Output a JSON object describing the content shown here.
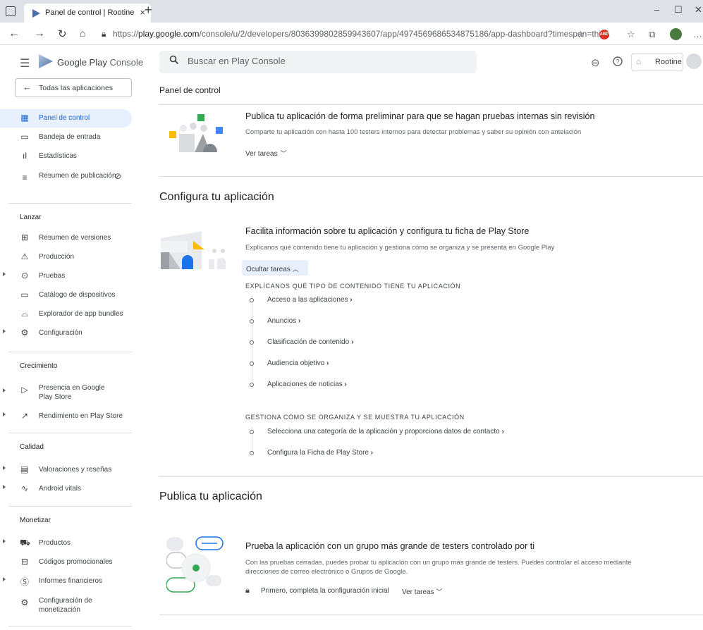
{
  "browser": {
    "tab_title": "Panel de control | Rootine",
    "tab_close": "×",
    "new_tab": "+",
    "url_prefix": "https://",
    "url_domain": "play.google.com",
    "url_path": "/console/u/2/developers/8036399802859943607/app/4974569686534875186/app-dashboard?timespan=thir...",
    "abp_label": "ABP"
  },
  "header": {
    "brand_main": "Google Play",
    "brand_sub": "Console",
    "search_placeholder": "Buscar en Play Console",
    "developer_name": "Rootine"
  },
  "sidebar": {
    "back_label": "Todas las aplicaciones",
    "top_items": [
      {
        "label": "Panel de control",
        "icon": "dashboard-icon"
      },
      {
        "label": "Bandeja de entrada",
        "icon": "inbox-icon"
      },
      {
        "label": "Estadísticas",
        "icon": "bar-chart-icon"
      },
      {
        "label": "Resumen de publicación",
        "icon": "publishing-overview-icon"
      }
    ],
    "sections": [
      {
        "title": "Lanzar",
        "items": [
          {
            "label": "Resumen de versiones"
          },
          {
            "label": "Producción"
          },
          {
            "label": "Pruebas"
          },
          {
            "label": "Catálogo de dispositivos"
          },
          {
            "label": "Explorador de app bundles"
          },
          {
            "label": "Configuración"
          }
        ]
      },
      {
        "title": "Crecimiento",
        "items": [
          {
            "label": "Presencia en Google Play Store"
          },
          {
            "label": "Rendimiento en Play Store"
          }
        ]
      },
      {
        "title": "Calidad",
        "items": [
          {
            "label": "Valoraciones y reseñas"
          },
          {
            "label": "Android vitals"
          }
        ]
      },
      {
        "title": "Monetizar",
        "items": [
          {
            "label": "Productos"
          },
          {
            "label": "Códigos promocionales"
          },
          {
            "label": "Informes financieros"
          },
          {
            "label": "Configuración de monetización"
          }
        ]
      }
    ]
  },
  "main": {
    "page_title": "Panel de control",
    "internal_test": {
      "title": "Publica tu aplicación de forma preliminar para que se hagan pruebas internas sin revisión",
      "description": "Comparte tu aplicación con hasta 100 testers internos para detectar problemas y saber su opinión con antelación",
      "tasks_label": "Ver tareas"
    },
    "setup": {
      "heading": "Configura tu aplicación",
      "title": "Facilita información sobre tu aplicación y configura tu ficha de Play Store",
      "description": "Explícanos qué contenido tiene tu aplicación y gestiona cómo se organiza y se presenta en Google Play",
      "hide_label": "Ocultar tareas",
      "group1_title": "EXPLÍCANOS QUÉ TIPO DE CONTENIDO TIENE TU APLICACIÓN",
      "group1_tasks": [
        "Acceso a las aplicaciones",
        "Anuncios",
        "Clasificación de contenido",
        "Audiencia objetivo",
        "Aplicaciones de noticias"
      ],
      "group2_title": "GESTIONA CÓMO SE ORGANIZA Y SE MUESTRA TU APLICACIÓN",
      "group2_tasks": [
        "Selecciona una categoría de la aplicación y proporciona datos de contacto",
        "Configura la Ficha de Play Store"
      ],
      "task_arrow": "›"
    },
    "publish": {
      "heading": "Publica tu aplicación",
      "title": "Prueba la aplicación con un grupo más grande de testers controlado por ti",
      "description": "Con las pruebas cerradas, puedes probar tu aplicación con un grupo más grande de testers. Puedes controlar el acceso mediante direcciones de correo electrónico o Grupos de Google.",
      "lock_text": "Primero, completa la configuración inicial",
      "tasks_label": "Ver tareas"
    }
  },
  "colors": {
    "accent": "#1967d2",
    "active_bg": "#e8f0fe",
    "divider": "#dadce0"
  }
}
